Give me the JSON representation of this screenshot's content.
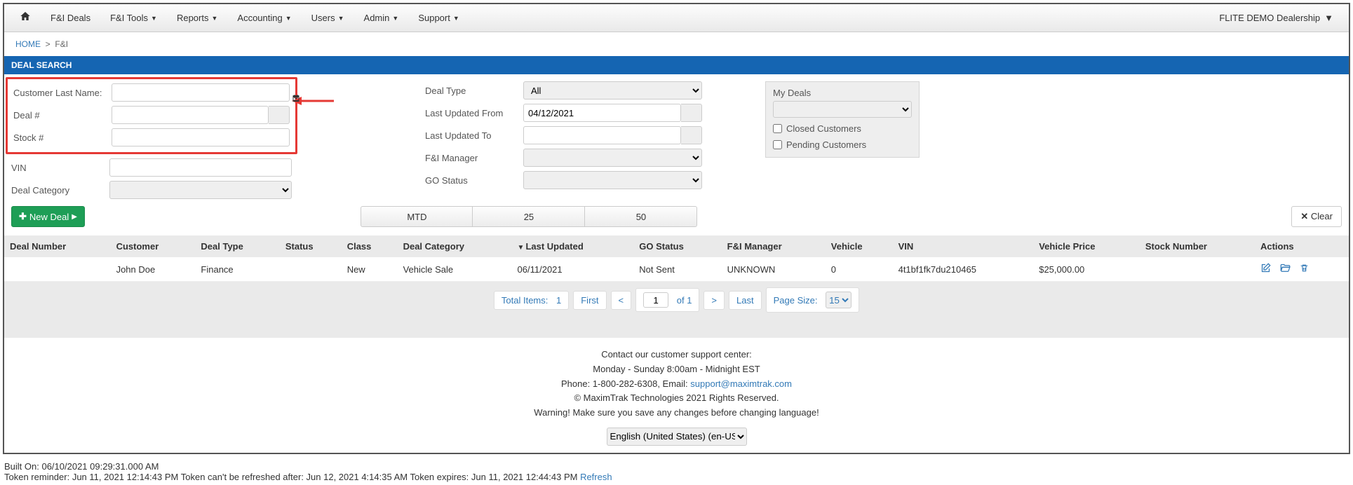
{
  "nav": {
    "items": [
      "F&I Deals",
      "F&I Tools",
      "Reports",
      "Accounting",
      "Users",
      "Admin",
      "Support"
    ],
    "has_dropdown": [
      false,
      true,
      true,
      true,
      true,
      true,
      true
    ],
    "dealership": "FLITE DEMO Dealership"
  },
  "breadcrumb": {
    "home": "HOME",
    "sep": ">",
    "current": "F&I"
  },
  "section_title": "DEAL SEARCH",
  "search": {
    "col1": {
      "customer_last_name_lbl": "Customer Last Name:",
      "deal_no_lbl": "Deal #",
      "stock_no_lbl": "Stock #",
      "vin_lbl": "VIN",
      "deal_category_lbl": "Deal Category"
    },
    "col2": {
      "deal_type_lbl": "Deal Type",
      "deal_type_val": "All",
      "last_updated_from_lbl": "Last Updated From",
      "last_updated_from_val": "04/12/2021",
      "last_updated_to_lbl": "Last Updated To",
      "fi_manager_lbl": "F&I Manager",
      "go_status_lbl": "GO Status"
    },
    "mydeals": {
      "title": "My Deals",
      "closed": "Closed Customers",
      "pending": "Pending Customers"
    }
  },
  "buttons": {
    "new_deal": "New Deal",
    "clear": "Clear",
    "tabs": [
      "MTD",
      "25",
      "50"
    ]
  },
  "table": {
    "headers": [
      "Deal Number",
      "Customer",
      "Deal Type",
      "Status",
      "Class",
      "Deal Category",
      "Last Updated",
      "GO Status",
      "F&I Manager",
      "Vehicle",
      "VIN",
      "Vehicle Price",
      "Stock Number",
      "Actions"
    ],
    "sorted_col": "Last Updated",
    "rows": [
      {
        "deal_number": "",
        "customer": "John Doe",
        "deal_type": "Finance",
        "status": "",
        "class": "New",
        "deal_category": "Vehicle Sale",
        "last_updated": "06/11/2021",
        "go_status": "Not Sent",
        "fi_manager": "UNKNOWN",
        "vehicle": "0",
        "vin": "4t1bf1fk7du210465",
        "vehicle_price": "$25,000.00",
        "stock_number": ""
      }
    ]
  },
  "paginator": {
    "total_items_lbl": "Total Items:",
    "total_items": "1",
    "first": "First",
    "prev": "<",
    "page": "1",
    "of_lbl": "of 1",
    "next": ">",
    "last": "Last",
    "page_size_lbl": "Page Size:",
    "page_size": "15"
  },
  "footer": {
    "line1": "Contact our customer support center:",
    "line2": "Monday - Sunday 8:00am - Midnight EST",
    "line3a": "Phone: 1-800-282-6308, Email: ",
    "email": "support@maximtrak.com",
    "line4": "© MaximTrak Technologies 2021 Rights Reserved.",
    "line5": "Warning! Make sure you save any changes before changing language!",
    "language": "English (United States) (en-US)"
  },
  "build": {
    "built_on": "Built On: 06/10/2021 09:29:31.000 AM",
    "token_line": "Token reminder: Jun 11, 2021 12:14:43 PM  Token can't be refreshed after: Jun 12, 2021 4:14:35 AM  Token expires: Jun 11, 2021 12:44:43 PM  ",
    "refresh": "Refresh"
  }
}
